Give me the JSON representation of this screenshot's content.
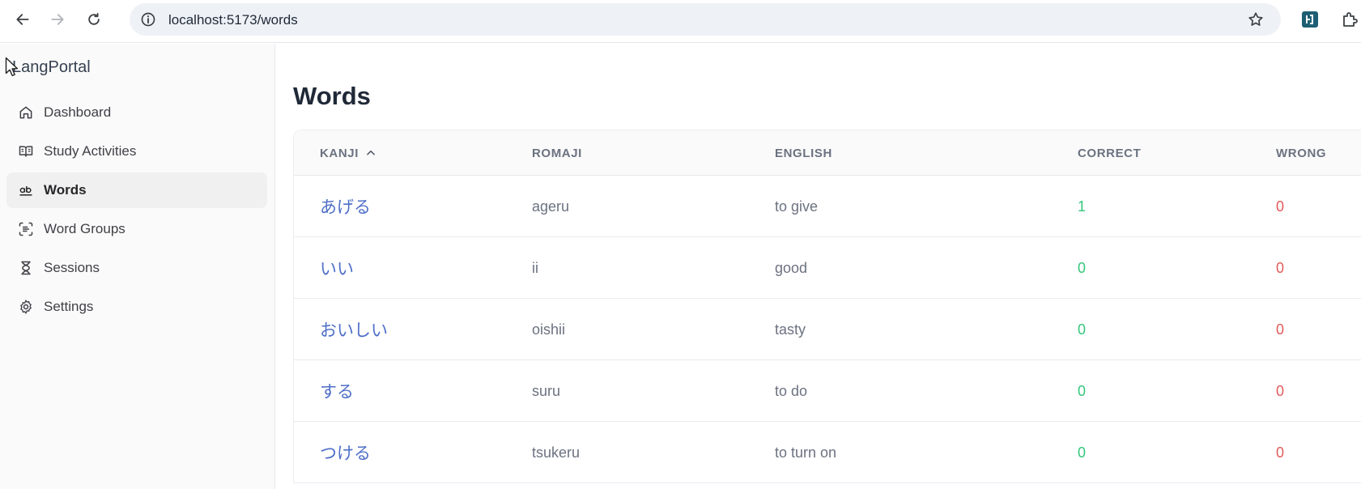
{
  "browser": {
    "url": "localhost:5173/words",
    "icons": [
      "back-icon",
      "forward-icon",
      "reload-icon",
      "site-info-icon",
      "bookmark-star-icon",
      "extension-icon",
      "extensions-puzzle-icon"
    ]
  },
  "sidebar": {
    "brand": "LangPortal",
    "items": [
      {
        "label": "Dashboard",
        "icon": "home-icon",
        "active": false
      },
      {
        "label": "Study Activities",
        "icon": "book-open-icon",
        "active": false
      },
      {
        "label": "Words",
        "icon": "whole-word-icon",
        "active": true
      },
      {
        "label": "Word Groups",
        "icon": "scan-text-icon",
        "active": false
      },
      {
        "label": "Sessions",
        "icon": "hourglass-icon",
        "active": false
      },
      {
        "label": "Settings",
        "icon": "gear-icon",
        "active": false
      }
    ]
  },
  "main": {
    "title": "Words",
    "table": {
      "columns": [
        "KANJI",
        "ROMAJI",
        "ENGLISH",
        "CORRECT",
        "WRONG"
      ],
      "sort_column": "KANJI",
      "sort_direction": "ascending",
      "rows": [
        {
          "kanji": "あげる",
          "romaji": "ageru",
          "english": "to give",
          "correct": "1",
          "wrong": "0"
        },
        {
          "kanji": "いい",
          "romaji": "ii",
          "english": "good",
          "correct": "0",
          "wrong": "0"
        },
        {
          "kanji": "おいしい",
          "romaji": "oishii",
          "english": "tasty",
          "correct": "0",
          "wrong": "0"
        },
        {
          "kanji": "する",
          "romaji": "suru",
          "english": "to do",
          "correct": "0",
          "wrong": "0"
        },
        {
          "kanji": "つける",
          "romaji": "tsukeru",
          "english": "to turn on",
          "correct": "0",
          "wrong": "0"
        }
      ]
    }
  },
  "colors": {
    "link": "#4f6fc7",
    "correct": "#34c77b",
    "wrong": "#e15a5a",
    "sidebar_bg": "#fafafa",
    "active_item_bg": "#f0f0f0"
  }
}
